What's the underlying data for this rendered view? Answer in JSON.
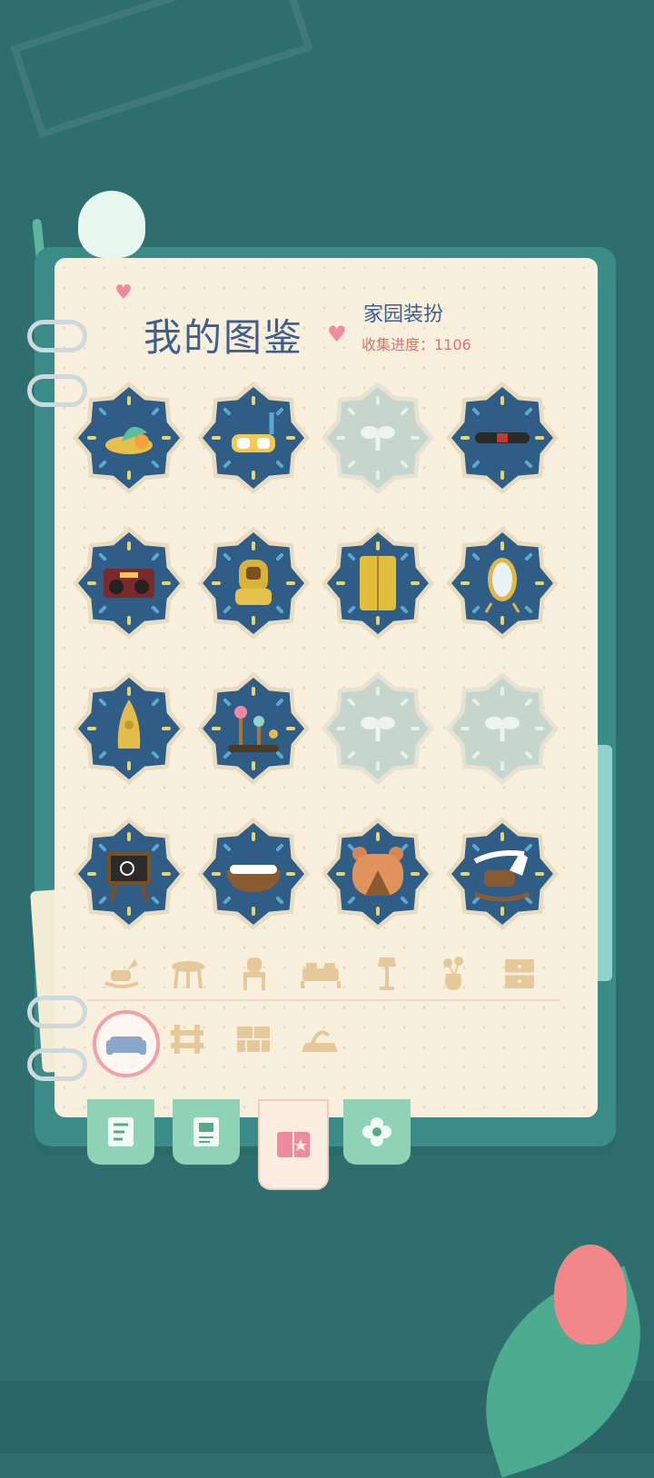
{
  "header": {
    "title": "我的图鉴",
    "category": "家园装扮",
    "progress": "收集进度：1106"
  },
  "colors": {
    "page": "#f8efdc",
    "slot_owned": "#2f5d86",
    "slot_locked": "#c7d6cd",
    "accent_pink": "#f2a1ab",
    "filter_icon": "#e6c99a",
    "tab_green": "#8fd3b6"
  },
  "grid": [
    {
      "item": "leaf-boat-icon",
      "owned": true
    },
    {
      "item": "diving-goggles-icon",
      "owned": true
    },
    {
      "item": "locked-sprout-icon",
      "owned": false
    },
    {
      "item": "skateboard-icon",
      "owned": true
    },
    {
      "item": "boombox-icon",
      "owned": true
    },
    {
      "item": "golden-chair-icon",
      "owned": true
    },
    {
      "item": "refrigerator-icon",
      "owned": true
    },
    {
      "item": "standing-mirror-icon",
      "owned": true
    },
    {
      "item": "rocket-icon",
      "owned": true
    },
    {
      "item": "mushroom-lamp-icon",
      "owned": true
    },
    {
      "item": "locked-sprout-icon",
      "owned": false
    },
    {
      "item": "locked-sprout-icon",
      "owned": false
    },
    {
      "item": "chalkboard-icon",
      "owned": true
    },
    {
      "item": "bathtub-icon",
      "owned": true
    },
    {
      "item": "bear-pet-bed-icon",
      "owned": true
    },
    {
      "item": "rocking-horse-icon",
      "owned": true
    }
  ],
  "filters_row1": [
    "rocking-horse-icon",
    "stool-icon",
    "chair-icon",
    "bed-icon",
    "floor-lamp-icon",
    "vase-icon",
    "cabinet-icon"
  ],
  "filters_row2": [
    "sofa-icon",
    "fence-icon",
    "wall-icon",
    "floor-icon"
  ],
  "tabs": [
    "journal-icon",
    "photo-album-icon",
    "collection-book-icon",
    "flower-icon"
  ],
  "active_tab": "collection-book-icon"
}
